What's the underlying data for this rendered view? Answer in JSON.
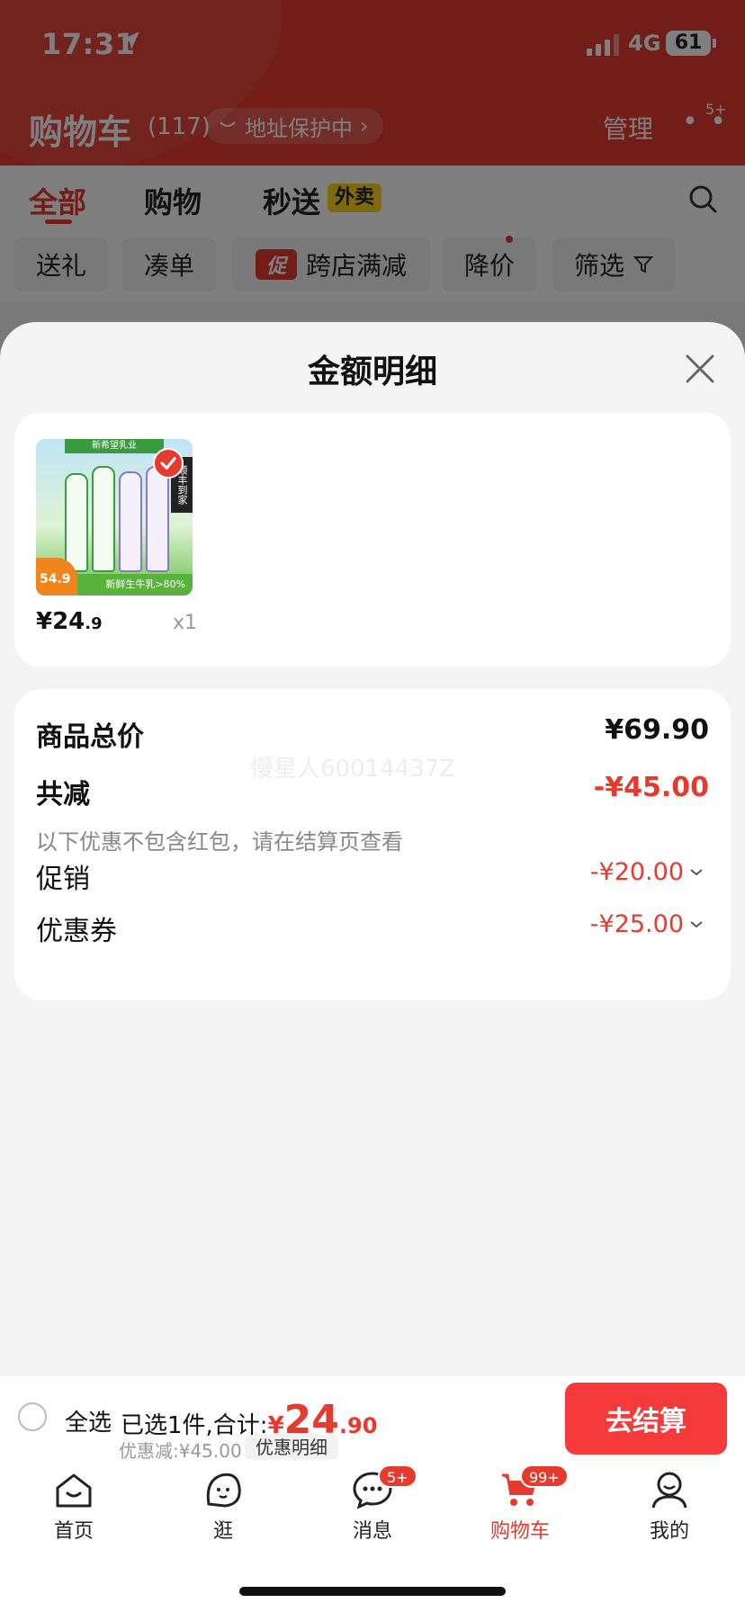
{
  "status": {
    "time": "17:31",
    "network": "4G",
    "battery": "61"
  },
  "header": {
    "title": "购物车",
    "count": "(117)",
    "address": "地址保护中",
    "manage": "管理",
    "more_badge": "5+"
  },
  "tabs": [
    {
      "label": "全部",
      "active": true
    },
    {
      "label": "购物"
    },
    {
      "label": "秒送"
    }
  ],
  "tab_badge": "外卖",
  "filters": [
    {
      "label": "送礼"
    },
    {
      "label": "凑单"
    },
    {
      "tag": "促",
      "label": "跨店满减"
    },
    {
      "label": "降价"
    },
    {
      "label": "筛选"
    }
  ],
  "sheet": {
    "title": "金额明细",
    "item": {
      "price_int": "¥24",
      "price_dec": ".9",
      "qty": "x1",
      "image_text": {
        "brand": "新希望乳业",
        "sf": "顺丰到家",
        "bottom": "新鲜生牛乳>80%",
        "price": "54.9"
      }
    },
    "summary": {
      "total_label": "商品总价",
      "total_value": "¥69.90",
      "reduce_label": "共减",
      "reduce_value": "-¥45.00",
      "note": "以下优惠不包含红包，请在结算页查看",
      "watermark": "慢星人60014437Z",
      "promo_label": "促销",
      "promo_value": "-¥20.00",
      "coupon_label": "优惠券",
      "coupon_value": "-¥25.00"
    }
  },
  "checkout": {
    "select_all": "全选",
    "selected_text": "已选1件,合计:",
    "currency": "¥",
    "total_int": "24",
    "total_dec": ".90",
    "discount": "优惠减:¥45.00",
    "detail_link": "优惠明细",
    "button": "去结算"
  },
  "tabbar": [
    {
      "label": "首页",
      "icon": "home-icon"
    },
    {
      "label": "逛",
      "icon": "explore-icon"
    },
    {
      "label": "消息",
      "icon": "message-icon",
      "badge": "5+"
    },
    {
      "label": "购物车",
      "icon": "cart-icon",
      "badge": "99+",
      "active": true
    },
    {
      "label": "我的",
      "icon": "profile-icon"
    }
  ],
  "colors": {
    "accent": "#e53a2e",
    "button": "#f43a3a",
    "badge_yellow": "#ffd21e"
  }
}
